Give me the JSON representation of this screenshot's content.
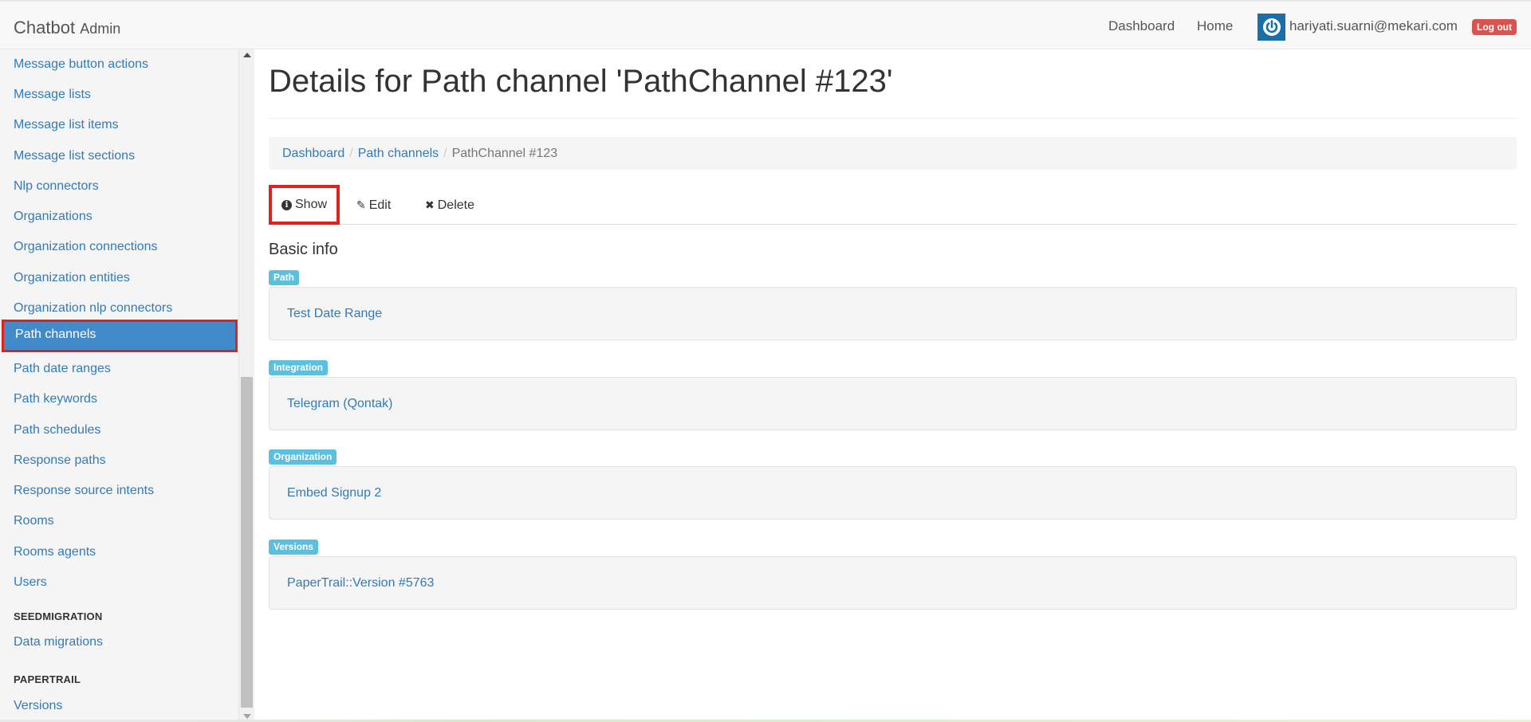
{
  "navbar": {
    "brand": "Chatbot",
    "brand_sub": "Admin",
    "links": [
      "Dashboard",
      "Home"
    ],
    "user_email": "hariyati.suarni@mekari.com",
    "logout": "Log out"
  },
  "sidebar": {
    "items": [
      "Message button actions",
      "Message lists",
      "Message list items",
      "Message list sections",
      "Nlp connectors",
      "Organizations",
      "Organization connections",
      "Organization entities",
      "Organization nlp connectors",
      "Path channels",
      "Path date ranges",
      "Path keywords",
      "Path schedules",
      "Response paths",
      "Response source intents",
      "Rooms",
      "Rooms agents",
      "Users"
    ],
    "sections": [
      {
        "header": "SEEDMIGRATION",
        "items": [
          "Data migrations"
        ]
      },
      {
        "header": "PAPERTRAIL",
        "items": [
          "Versions"
        ]
      }
    ]
  },
  "main": {
    "title": "Details for Path channel 'PathChannel #123'",
    "breadcrumb": [
      "Dashboard",
      "Path channels",
      "PathChannel #123"
    ],
    "tabs": [
      "Show",
      "Edit",
      "Delete"
    ],
    "section_title": "Basic info",
    "fields": [
      {
        "label": "Path",
        "value": "Test Date Range"
      },
      {
        "label": "Integration",
        "value": "Telegram (Qontak)"
      },
      {
        "label": "Organization",
        "value": "Embed Signup 2"
      },
      {
        "label": "Versions",
        "value": "PaperTrail::Version #5763"
      }
    ]
  }
}
